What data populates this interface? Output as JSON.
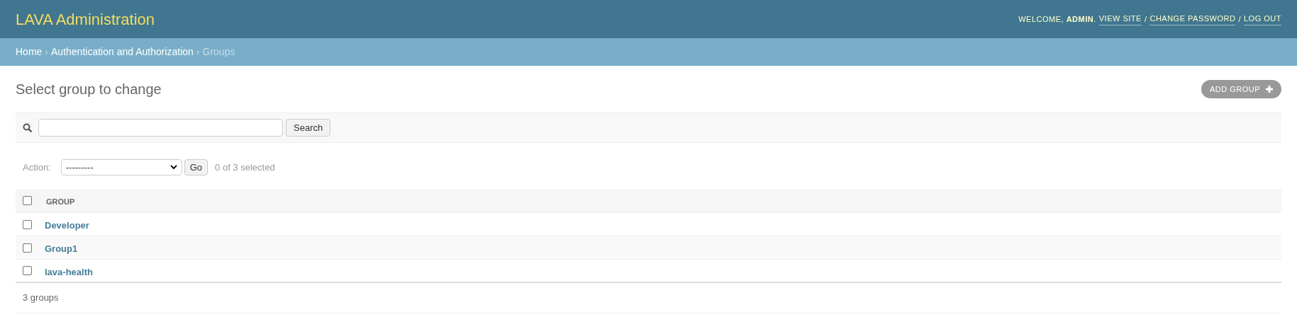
{
  "header": {
    "brand": "LAVA Administration",
    "welcome": "WELCOME, **ADMIN**.",
    "user_tools": [
      {
        "kind": "link",
        "text": "VIEW SITE"
      },
      {
        "kind": "separator",
        "text": "/"
      },
      {
        "kind": "link",
        "text": "CHANGE PASSWORD"
      },
      {
        "kind": "separator",
        "text": "/"
      },
      {
        "kind": "link",
        "text": "LOG OUT"
      }
    ]
  },
  "breadcrumbs": [
    {
      "kind": "link",
      "text": "Home"
    },
    {
      "kind": "separator",
      "text": "›"
    },
    {
      "kind": "link",
      "text": "Authentication and Authorization"
    },
    {
      "kind": "separator",
      "text": "›"
    },
    {
      "kind": "current",
      "text": "Groups"
    }
  ],
  "page_title": "Select group to change",
  "add_button": "ADD GROUP",
  "search": {
    "button": "Search"
  },
  "actions": {
    "label": "Action:",
    "select_value": "---------",
    "go": "Go",
    "counter": "0 of 3 selected"
  },
  "table": {
    "select_all_checked": false,
    "columns": [
      "GROUP"
    ],
    "rows": [
      {
        "name": "Developer",
        "checked": false
      },
      {
        "name": "Group1",
        "checked": false
      },
      {
        "name": "lava-health",
        "checked": false
      }
    ]
  },
  "footer": "3 groups"
}
